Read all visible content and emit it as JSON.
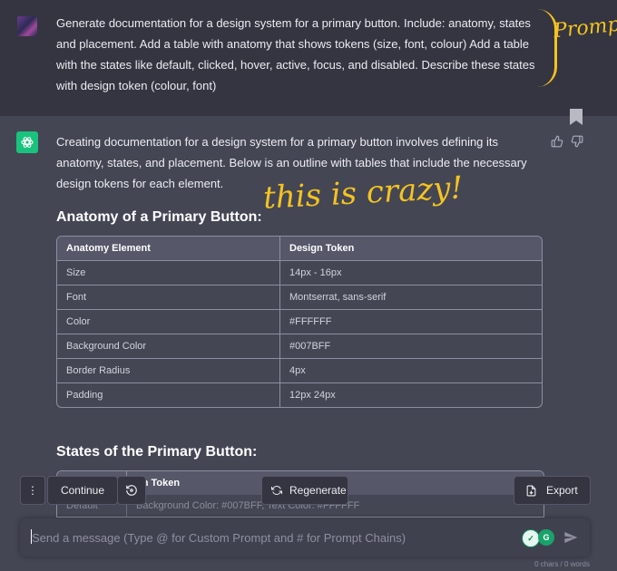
{
  "user_message": "Generate documentation for a design system for a primary button. Include: anatomy, states and placement. Add a table with anatomy that shows tokens (size, font, colour) Add a table with the states like default, clicked, hover, active, focus, and disabled. Describe these states with design token (colour, font)",
  "annotations": {
    "prompt": "Prompt",
    "crazy": "this is crazy!"
  },
  "reply": {
    "intro": "Creating documentation for a design system for a primary button involves defining its anatomy, states, and placement. Below is an outline with tables that include the necessary design tokens for each element.",
    "anatomy_heading": "Anatomy of a Primary Button:",
    "anatomy_table": {
      "headers": [
        "Anatomy Element",
        "Design Token"
      ],
      "rows": [
        [
          "Size",
          "14px - 16px"
        ],
        [
          "Font",
          "Montserrat, sans-serif"
        ],
        [
          "Color",
          "#FFFFFF"
        ],
        [
          "Background Color",
          "#007BFF"
        ],
        [
          "Border Radius",
          "4px"
        ],
        [
          "Padding",
          "12px 24px"
        ]
      ]
    },
    "states_heading": "States of the Primary Button:",
    "states_table": {
      "header_partial": "gn Token",
      "row_state": "Default",
      "row_token": "Background Color: #007BFF, Text Color: #FFFFFF"
    }
  },
  "toolbar": {
    "dots": "⋮",
    "continue": "Continue",
    "regenerate": "Regenerate",
    "export": "Export"
  },
  "input": {
    "placeholder": "Send a message (Type @ for Custom Prompt and # for Prompt Chains)"
  },
  "counter": "0 chars / 0 words",
  "colors": {
    "background": "#444654",
    "user_block": "#343541",
    "accent_green": "#19c37d",
    "annotation": "#f5c320"
  }
}
